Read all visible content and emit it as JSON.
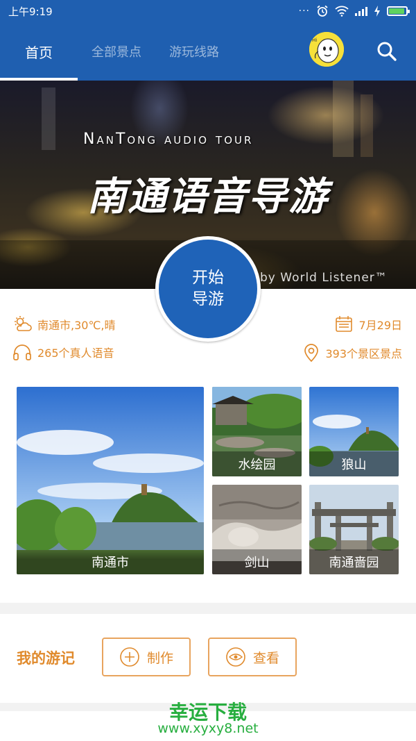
{
  "status_bar": {
    "time": "上午9:19"
  },
  "app_bar": {
    "tabs": [
      {
        "label": "首页",
        "active": true
      },
      {
        "label": "全部景点",
        "active": false
      },
      {
        "label": "游玩线路",
        "active": false
      }
    ]
  },
  "banner": {
    "title_en": "NanTong audio tour",
    "title_cn": "南通语音导游",
    "credit": "by World Listener™"
  },
  "start_button": {
    "line1": "开始",
    "line2": "导游"
  },
  "info": {
    "weather": "南通市,30℃,晴",
    "date": "7月29日",
    "voices": "265个真人语音",
    "spots": "393个景区景点"
  },
  "tiles": [
    {
      "label": "南通市"
    },
    {
      "label": "水绘园"
    },
    {
      "label": "狼山"
    },
    {
      "label": "剑山"
    },
    {
      "label": "南通啬园"
    }
  ],
  "journal": {
    "title": "我的游记",
    "make_label": "制作",
    "view_label": "查看"
  },
  "watermark": {
    "title": "幸运下载",
    "url": "www.xyxy8.net"
  },
  "colors": {
    "primary": "#1f5fb0",
    "accent": "#e08a2c",
    "watermark": "#27ae3f"
  }
}
